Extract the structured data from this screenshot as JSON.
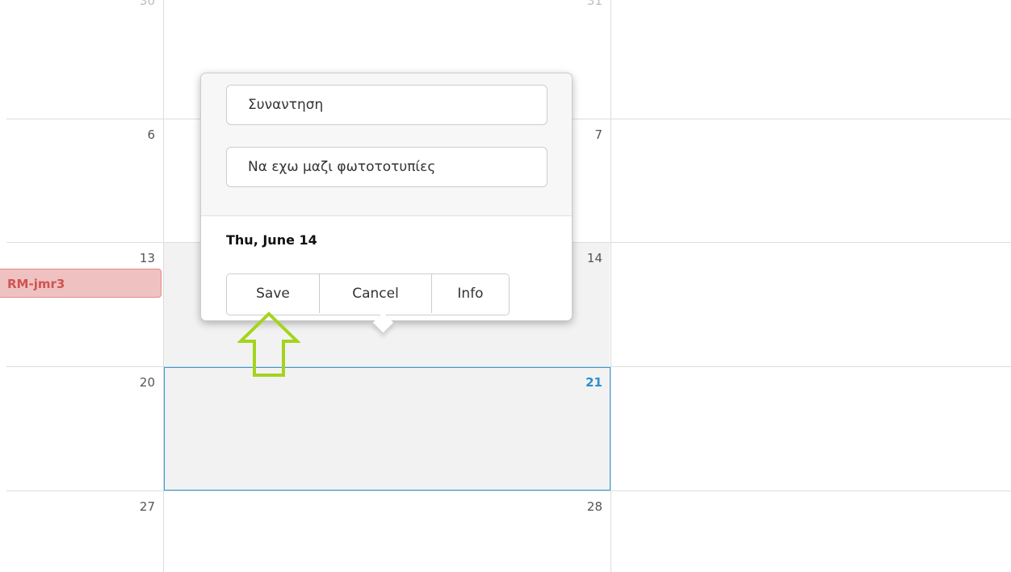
{
  "calendar": {
    "weeks": [
      {
        "left_day": "30",
        "right_day": "31"
      },
      {
        "left_day": "6",
        "right_day": "7"
      },
      {
        "left_day": "13",
        "right_day": "14"
      },
      {
        "left_day": "20",
        "right_day": "21"
      },
      {
        "left_day": "27",
        "right_day": "28"
      }
    ],
    "today_day": "21",
    "event_label": "RM-jmr3"
  },
  "popover": {
    "title_value": "Συναντηση",
    "description_value": "Να εχω μαζι φωτοτοτυπίες",
    "date_label": "Thu, June 14",
    "save_label": "Save",
    "cancel_label": "Cancel",
    "info_label": "Info"
  },
  "colors": {
    "accent": "#2f9bd7",
    "event_bg": "#f0c1c1",
    "event_text": "#d05353",
    "arrow": "#a4d41c"
  },
  "icons": {
    "annotation": "up-arrow-icon"
  }
}
